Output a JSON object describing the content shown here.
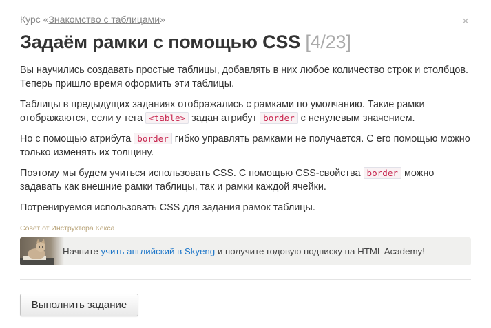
{
  "header": {
    "course_prefix": "Курс «",
    "course_link": "Знакомство с таблицами",
    "course_suffix": "»",
    "close_glyph": "×",
    "title": "Задаём рамки с помощью CSS",
    "counter": "[4/23]"
  },
  "content": {
    "p1": "Вы научились создавать простые таблицы, добавлять в них любое количество строк и столбцов. Теперь пришло время оформить эти таблицы.",
    "p2_a": "Таблицы в предыдущих заданиях отображались с рамками по умолчанию. Такие рамки отображаются, если у тега",
    "p2_code1": "<table>",
    "p2_b": "задан атрибут",
    "p2_code2": "border",
    "p2_c": "с ненулевым значением.",
    "p3_a": "Но с помощью атрибута",
    "p3_code": "border",
    "p3_b": "гибко управлять рамками не получается. С его помощью можно только изменять их толщину.",
    "p4_a": "Поэтому мы будем учиться использовать CSS. С помощью CSS-свойства",
    "p4_code": "border",
    "p4_b": "можно задавать как внешние рамки таблицы, так и рамки каждой ячейки.",
    "p5": "Потренируемся использовать CSS для задания рамок таблицы."
  },
  "tip": {
    "label": "Совет от Инструктора Кекса",
    "text_a": "Начните",
    "link": "учить английский в Skyeng",
    "text_b": "и получите годовую подписку на HTML Academy!"
  },
  "footer": {
    "submit_label": "Выполнить задание"
  },
  "colors": {
    "link": "#1f77c9",
    "code_text": "#c7254e",
    "tip_label": "#b9a47a",
    "tip_bg": "#f0f0ee"
  },
  "icons": {
    "close": "close-icon",
    "cat": "cat-avatar-icon"
  }
}
